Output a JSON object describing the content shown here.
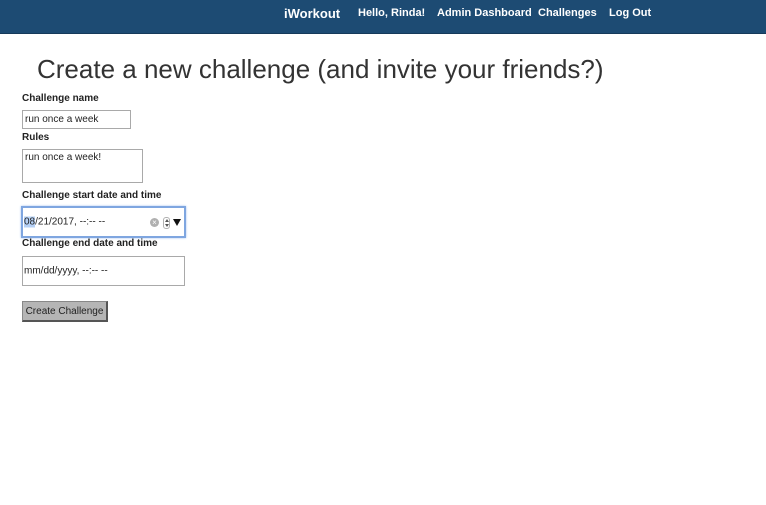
{
  "navbar": {
    "brand": "iWorkout",
    "links": [
      "Hello, Rinda!",
      "Admin Dashboard",
      "Challenges",
      "Log Out"
    ]
  },
  "page": {
    "title": "Create a new challenge (and invite your friends?)"
  },
  "form": {
    "name_label": "Challenge name",
    "name_value": "run once a week",
    "rules_label": "Rules",
    "rules_value": "run once a week!",
    "start_label": "Challenge start date and time",
    "start_month": "08",
    "start_rest": "/21/2017, --:-- --",
    "end_label": "Challenge end date and time",
    "end_placeholder": "mm/dd/yyyy, --:-- --",
    "submit_label": "Create Challenge"
  },
  "colors": {
    "navbar": "#1d4b73",
    "focus_ring": "#7fa6e0"
  },
  "icons": {
    "clear": "clear-icon",
    "spinner": "spinner-icon",
    "dropdown": "dropdown-arrow-icon"
  }
}
